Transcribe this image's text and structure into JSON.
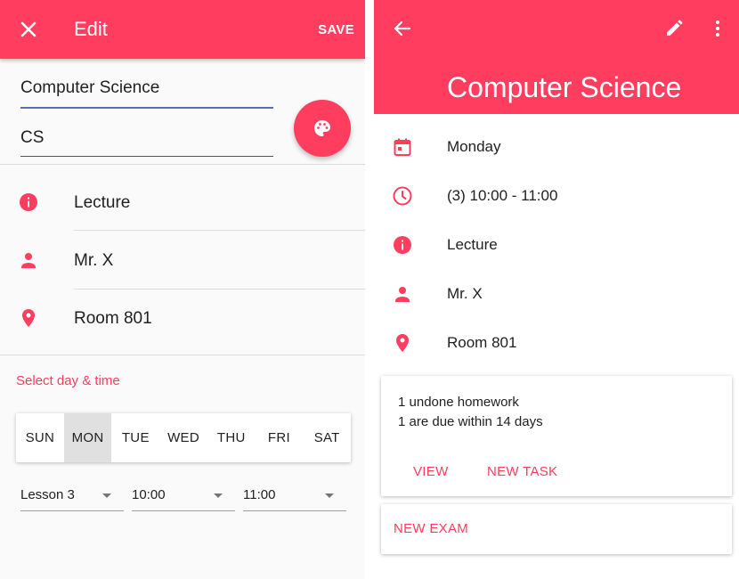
{
  "edit_screen": {
    "title": "Edit",
    "save_label": "SAVE",
    "subject_name": "Computer Science",
    "subject_abbr": "CS",
    "rows": [
      {
        "icon": "info-icon",
        "text": "Lecture"
      },
      {
        "icon": "person-icon",
        "text": "Mr. X"
      },
      {
        "icon": "location-icon",
        "text": "Room 801"
      }
    ],
    "section_label": "Select day & time",
    "days": [
      "SUN",
      "MON",
      "TUE",
      "WED",
      "THU",
      "FRI",
      "SAT"
    ],
    "selected_day": "MON",
    "lesson_select": "Lesson 3",
    "start_select": "10:00",
    "end_select": "11:00"
  },
  "detail_screen": {
    "title": "Computer Science",
    "rows": [
      {
        "icon": "calendar-icon",
        "text": "Monday"
      },
      {
        "icon": "clock-icon",
        "text": "(3) 10:00 - 11:00"
      },
      {
        "icon": "info-icon",
        "text": "Lecture"
      },
      {
        "icon": "person-icon",
        "text": "Mr. X"
      },
      {
        "icon": "location-icon",
        "text": "Room 801"
      }
    ],
    "homework_line1": "1 undone homework",
    "homework_line2": "1 are due within 14 days",
    "view_label": "VIEW",
    "new_task_label": "NEW TASK",
    "new_exam_label": "NEW EXAM"
  },
  "colors": {
    "accent": "#ff3d5f",
    "focus_underline": "#5c6bc0"
  }
}
